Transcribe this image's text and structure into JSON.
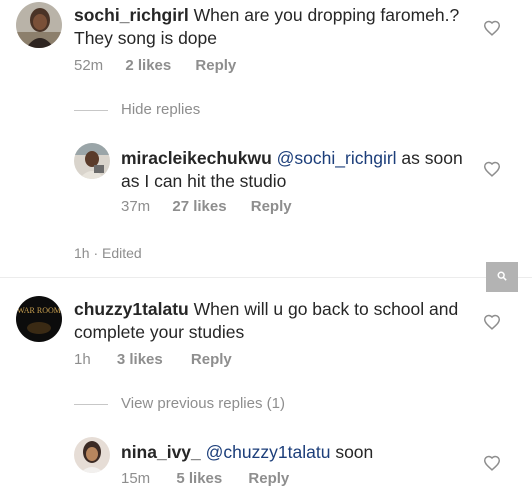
{
  "comments": [
    {
      "username": "sochi_richgirl",
      "text_line1": "When are you dropping faromeh.?",
      "text_line2": "They song is dope",
      "time": "52m",
      "likes": "2 likes",
      "reply": "Reply",
      "toggle": "Hide replies",
      "replies": [
        {
          "username": "miracleikechukwu",
          "mention": "@sochi_richgirl",
          "text_line1": "as soon",
          "text_line2": "as I can hit the studio",
          "time": "37m",
          "likes": "27 likes",
          "reply": "Reply"
        }
      ]
    },
    {
      "username": "chuzzy1talatu",
      "text_line1": "When will u go back to school and",
      "text_line2": "complete your studies",
      "time": "1h",
      "likes": "3 likes",
      "reply": "Reply",
      "toggle": "View previous replies (1)",
      "replies": [
        {
          "username": "nina_ivy_",
          "mention": "@chuzzy1talatu",
          "text_line1": "soon",
          "time": "15m",
          "likes": "5 likes",
          "reply": "Reply"
        }
      ]
    }
  ],
  "edited_text": "1h · Edited",
  "avatar_text": "WAR ROOM",
  "icons": {
    "like": "heart-icon",
    "search": "search-icon"
  },
  "colors": {
    "mention": "#1c3e7a",
    "secondary_text": "#8e8e8e",
    "search_button": "#b3b3b3"
  }
}
